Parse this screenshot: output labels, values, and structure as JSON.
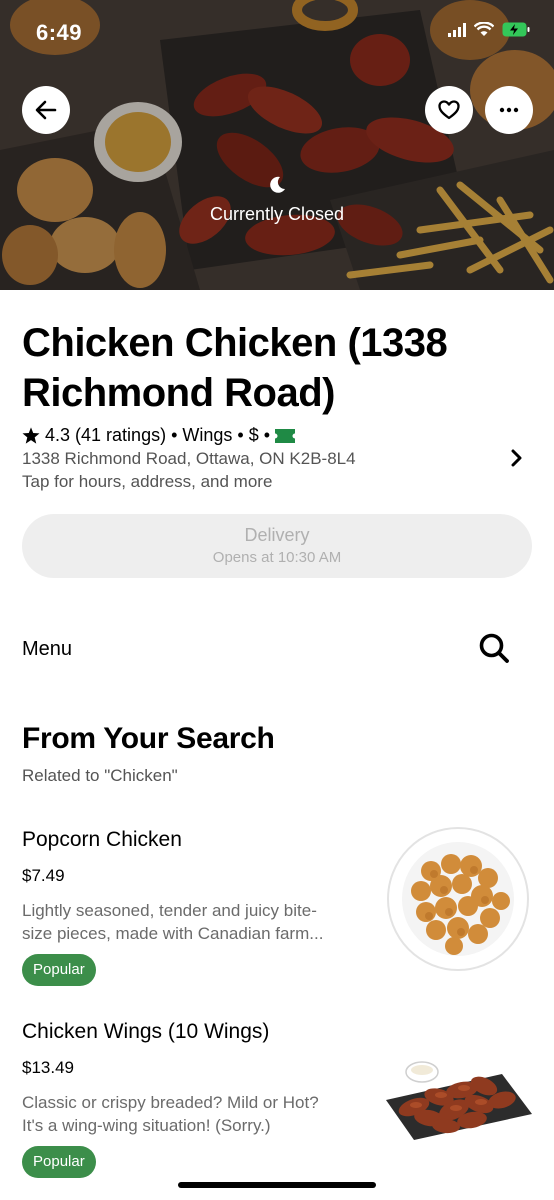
{
  "status_bar": {
    "time": "6:49"
  },
  "hero": {
    "closed_label": "Currently Closed"
  },
  "store": {
    "name": "Chicken Chicken (1338 Richmond Road)",
    "rating": "4.3",
    "ratings_count": "(41 ratings)",
    "category": "Wings",
    "price_level": "$",
    "address": "1338 Richmond Road, Ottawa, ON K2B-8L4",
    "details_hint": "Tap for hours, address, and more"
  },
  "delivery": {
    "label": "Delivery",
    "opens": "Opens at 10:30 AM"
  },
  "menu": {
    "label": "Menu"
  },
  "section": {
    "title": "From Your Search",
    "subtitle": "Related to \"Chicken\""
  },
  "items": [
    {
      "name": "Popcorn Chicken",
      "price": "$7.49",
      "desc1": "Lightly seasoned, tender and juicy bite-",
      "desc2": "size pieces, made with Canadian farm...",
      "badge": "Popular"
    },
    {
      "name": "Chicken Wings (10 Wings)",
      "price": "$13.49",
      "desc1": "Classic or crispy breaded? Mild or Hot?",
      "desc2": "It's a wing-wing situation! (Sorry.)",
      "badge": "Popular"
    }
  ],
  "colors": {
    "popular_badge": "#3c8e4a",
    "battery": "#33c759",
    "deals_icon": "#1f8a45"
  }
}
